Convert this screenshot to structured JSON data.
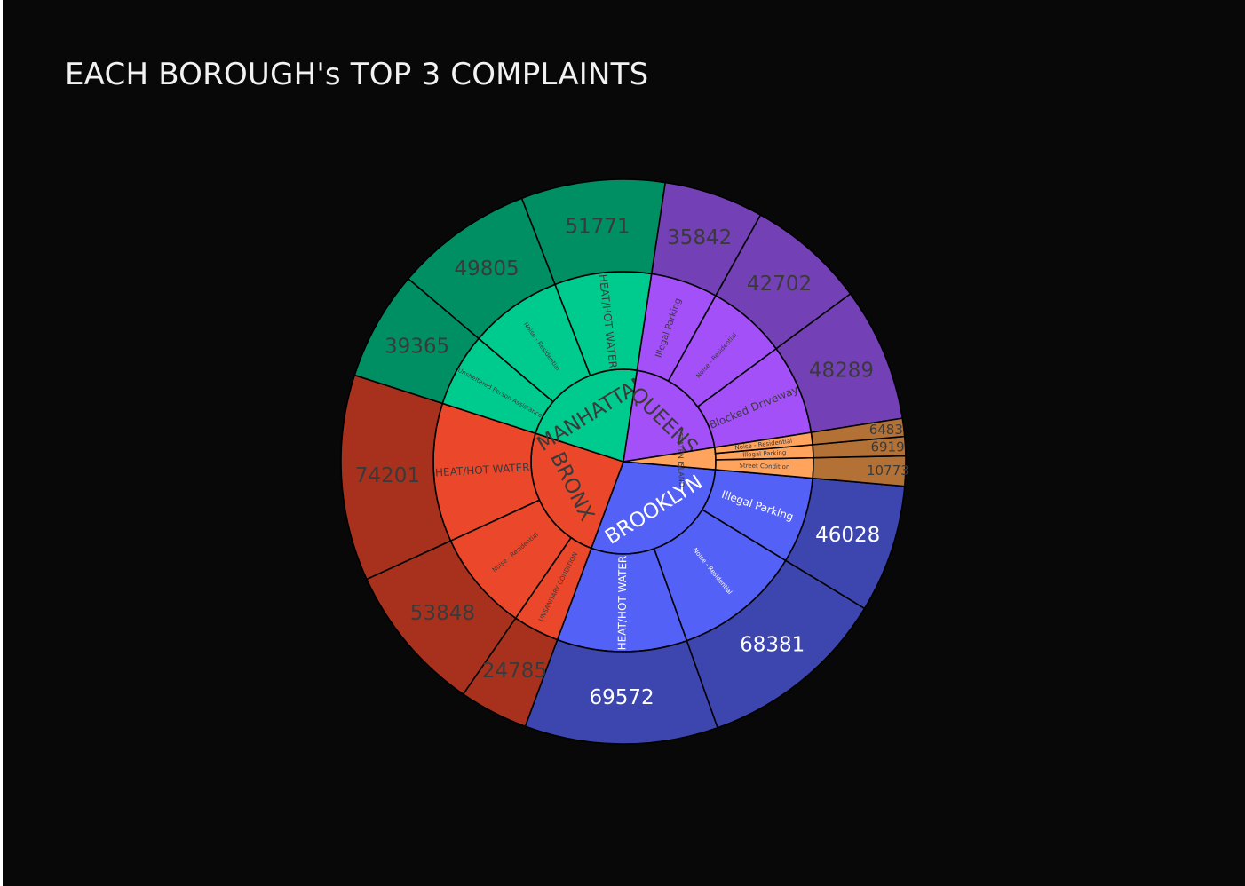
{
  "chart_data": {
    "type": "sunburst",
    "title": "EACH BOROUGH's TOP 3 COMPLAINTS",
    "legend": "none",
    "boroughs": [
      {
        "name": "BROOKLYN",
        "label": "BROOKLYN",
        "inner_color": "#5461f6",
        "outer_color": "#3d45ae",
        "text_color": "#ffffff",
        "complaints": [
          {
            "name": "HEAT/HOT WATER",
            "value": 69572
          },
          {
            "name": "Noise - Residential",
            "value": 68381
          },
          {
            "name": "Illegal Parking",
            "value": 46028
          }
        ]
      },
      {
        "name": "BRONX",
        "label": "BRONX",
        "inner_color": "#eb472b",
        "outer_color": "#a8311e",
        "text_color": "#3a3a3a",
        "complaints": [
          {
            "name": "HEAT/HOT WATER",
            "value": 74201
          },
          {
            "name": "Noise - Residential",
            "value": 53848
          },
          {
            "name": "UNSANITARY CONDITION",
            "value": 24785
          }
        ]
      },
      {
        "name": "MANHATTAN",
        "label": "MANHATTAN",
        "inner_color": "#00cb8f",
        "outer_color": "#008f63",
        "text_color": "#3a3a3a",
        "complaints": [
          {
            "name": "HEAT/HOT WATER",
            "value": 51771
          },
          {
            "name": "Noise - Residential",
            "value": 49805
          },
          {
            "name": "Unsheltered Person Assistance",
            "value": 39365
          }
        ]
      },
      {
        "name": "QUEENS",
        "label": "QUEENS",
        "inner_color": "#a350f8",
        "outer_color": "#7440b6",
        "text_color": "#3a3a3a",
        "complaints": [
          {
            "name": "Blocked Driveway",
            "value": 48289
          },
          {
            "name": "Noise - Residential",
            "value": 42702
          },
          {
            "name": "Illegal Parking",
            "value": 35842
          }
        ]
      },
      {
        "name": "STATEN ISLAND",
        "label": "STATEN ISLAND",
        "inner_color": "#ffa35d",
        "outer_color": "#b47135",
        "text_color": "#3a3a3a",
        "complaints": [
          {
            "name": "Street Condition",
            "value": 10773
          },
          {
            "name": "Illegal Parking",
            "value": 6919
          },
          {
            "name": "Noise - Residential",
            "value": 6483
          }
        ]
      }
    ]
  }
}
